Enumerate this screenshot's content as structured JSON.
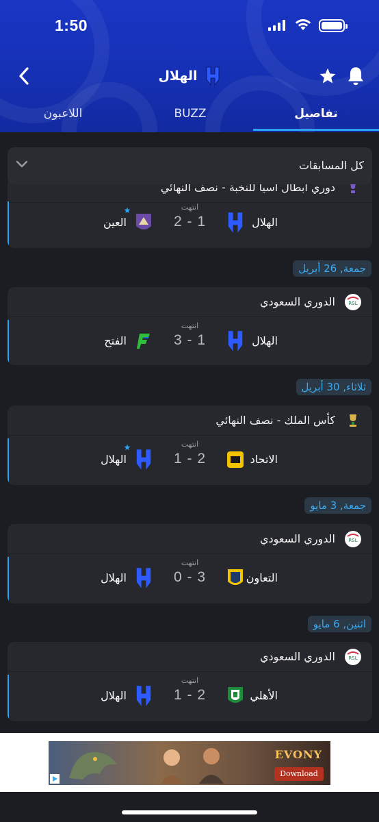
{
  "status_bar": {
    "time": "1:50"
  },
  "header": {
    "team_name": "الهلال"
  },
  "tabs": [
    {
      "label": "تفاصيل",
      "active": true
    },
    {
      "label": "BUZZ",
      "active": false
    },
    {
      "label": "اللاعبون",
      "active": false
    }
  ],
  "filter": {
    "label": "كل المسابقات"
  },
  "colors": {
    "accent": "#2ca3ef",
    "header_blue": "#1a36c4",
    "card_bg": "#26282d",
    "page_bg": "#1b1d22"
  },
  "matches": [
    {
      "date": "",
      "competition": "دوري أبطال آسيا للنخبة - نصف النهائي",
      "competition_icon": "afc-trophy-icon",
      "status": "انتهت",
      "home": {
        "name": "الهلال",
        "logo": "alhilal-logo"
      },
      "away": {
        "name": "العين",
        "logo": "alain-logo",
        "favorite": true
      },
      "score": "2 - 1"
    },
    {
      "date": "جمعة, 26 أبريل",
      "competition": "الدوري السعودي",
      "competition_icon": "rsl-logo",
      "status": "انتهت",
      "home": {
        "name": "الهلال",
        "logo": "alhilal-logo"
      },
      "away": {
        "name": "الفتح",
        "logo": "alfateh-logo"
      },
      "score": "3 - 1"
    },
    {
      "date": "ثلاثاء, 30 أبريل",
      "competition": "كأس الملك  - نصف النهائي",
      "competition_icon": "kings-cup-icon",
      "status": "انتهت",
      "home": {
        "name": "الاتحاد",
        "logo": "alittihad-logo"
      },
      "away": {
        "name": "الهلال",
        "logo": "alhilal-logo",
        "favorite": true
      },
      "score": "1 - 2"
    },
    {
      "date": "جمعة, 3 مايو",
      "competition": "الدوري السعودي",
      "competition_icon": "rsl-logo",
      "status": "انتهت",
      "home": {
        "name": "التعاون",
        "logo": "altaawoun-logo"
      },
      "away": {
        "name": "الهلال",
        "logo": "alhilal-logo"
      },
      "score": "0 - 3"
    },
    {
      "date": "اثنين, 6 مايو",
      "competition": "الدوري السعودي",
      "competition_icon": "rsl-logo",
      "status": "انتهت",
      "home": {
        "name": "الأهلي",
        "logo": "alahli-logo"
      },
      "away": {
        "name": "الهلال",
        "logo": "alhilal-logo"
      },
      "score": "1 - 2"
    }
  ],
  "ad": {
    "brand": "EVONY",
    "cta": "Download"
  }
}
